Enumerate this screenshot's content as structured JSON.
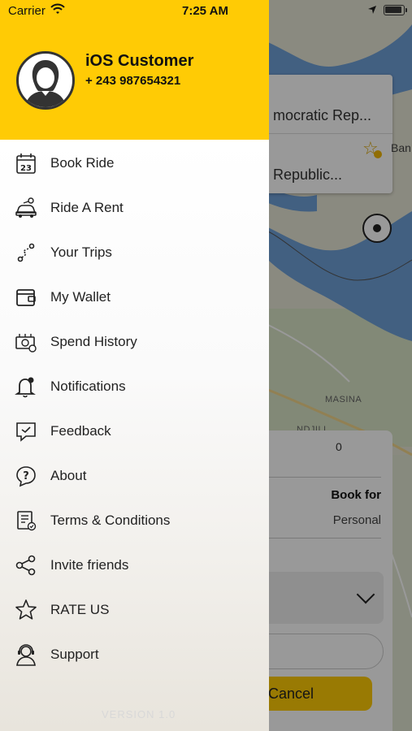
{
  "status_bar": {
    "carrier": "Carrier",
    "time": "7:25 AM"
  },
  "drawer": {
    "user_name": "iOS Customer",
    "user_phone": "+ 243 987654321",
    "items": [
      {
        "label": "Book Ride",
        "icon": "calendar-icon"
      },
      {
        "label": "Ride A Rent",
        "icon": "car-rent-icon"
      },
      {
        "label": "Your Trips",
        "icon": "route-icon"
      },
      {
        "label": "My Wallet",
        "icon": "wallet-icon"
      },
      {
        "label": "Spend History",
        "icon": "money-history-icon"
      },
      {
        "label": "Notifications",
        "icon": "bell-icon"
      },
      {
        "label": "Feedback",
        "icon": "feedback-icon"
      },
      {
        "label": "About",
        "icon": "question-icon"
      },
      {
        "label": "Terms & Conditions",
        "icon": "document-check-icon"
      },
      {
        "label": "Invite friends",
        "icon": "share-icon"
      },
      {
        "label": "RATE US",
        "icon": "star-icon"
      },
      {
        "label": "Support",
        "icon": "support-agent-icon"
      }
    ],
    "version": "VERSION 1.0"
  },
  "map": {
    "label_masina": "MASINA",
    "label_ndjili": "NDJILI",
    "pickup_text": "mocratic Rep...",
    "drop_text": "Republic...",
    "side_text": "Ban"
  },
  "booking": {
    "count": "0",
    "book_for_label": "Book for",
    "book_for_value": "Personal",
    "cancel_label": "Cancel"
  },
  "colors": {
    "brand_yellow": "#ffcb05",
    "water": "#6fa0d8"
  }
}
